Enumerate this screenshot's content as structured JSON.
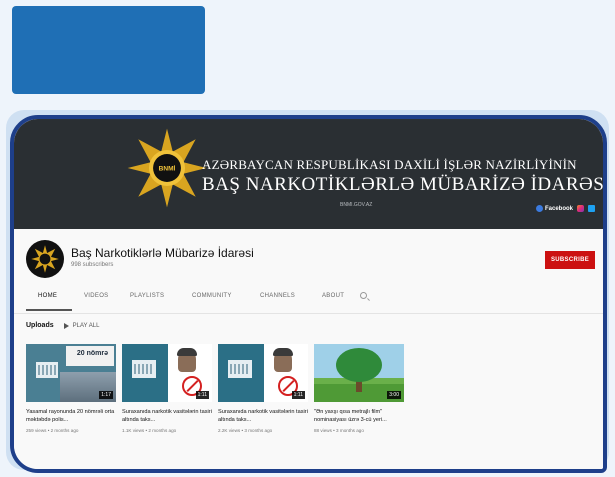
{
  "banner": {
    "line1": "AZƏRBAYCAN RESPUBLİKASI DAXİLİ İŞLƏR NAZİRLİYİNİN",
    "line2": "BAŞ NARKOTİKLƏRLƏ MÜBARİZƏ İDARƏSİ",
    "emblem_text": "BNMİ",
    "small_text": "BNMI.GOV.AZ",
    "facebook_label": "Facebook"
  },
  "channel": {
    "name": "Baş Narkotiklərlə Mübarizə İdarəsi",
    "subscribers": "998 subscribers",
    "subscribe_label": "SUBSCRIBE"
  },
  "tabs": [
    "HOME",
    "VIDEOS",
    "PLAYLISTS",
    "COMMUNITY",
    "CHANNELS",
    "ABOUT"
  ],
  "uploads": {
    "label": "Uploads",
    "play_all": "PLAY ALL",
    "videos": [
      {
        "title": "Yasamal rayonunda 20 nömrəli orta məktəbdə polis...",
        "meta": "259 views • 2 months ago",
        "duration": "1:17",
        "overlay": "20 nömrə"
      },
      {
        "title": "Suraxanıda narkotik vasitələrin tasiri altında taks...",
        "meta": "1.1K views • 2 months ago",
        "duration": "1:11"
      },
      {
        "title": "Suraxanıda narkotik vasitələrin tasiri altında taks...",
        "meta": "2.2K views • 3 months ago",
        "duration": "1:11"
      },
      {
        "title": "\"Ən yaxşı qısa metrajlı film\" nominasiyası üzrə 3-cü yeri...",
        "meta": "88 views • 3 months ago",
        "duration": "3:00"
      }
    ]
  },
  "colors": {
    "accent_tab": "#1f6fb5",
    "frame_border": "#1e3f8a",
    "banner_bg": "#2a2f33",
    "subscribe_bg": "#cc1111"
  }
}
